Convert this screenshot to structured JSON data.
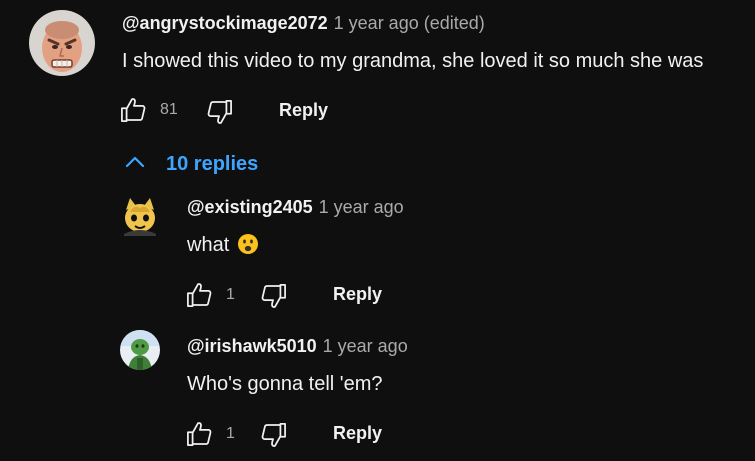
{
  "comment": {
    "author": "@angrystockimage2072",
    "time": "1 year ago (edited)",
    "text": "I showed this video to my grandma, she loved it so much she was",
    "likes": "81",
    "reply_label": "Reply"
  },
  "replies_toggle": {
    "label": "10 replies"
  },
  "replies": [
    {
      "author": "@existing2405",
      "time": "1 year ago",
      "text": "what",
      "emoji": "frowning-face-with-open-mouth",
      "likes": "1",
      "reply_label": "Reply"
    },
    {
      "author": "@irishawk5010",
      "time": "1 year ago",
      "text": "Who's gonna tell 'em?",
      "likes": "1",
      "reply_label": "Reply"
    }
  ],
  "colors": {
    "background": "#0f0f0f",
    "primary_text": "#f1f1f1",
    "secondary_text": "#aaaaaa",
    "link_blue": "#3ea6ff"
  }
}
